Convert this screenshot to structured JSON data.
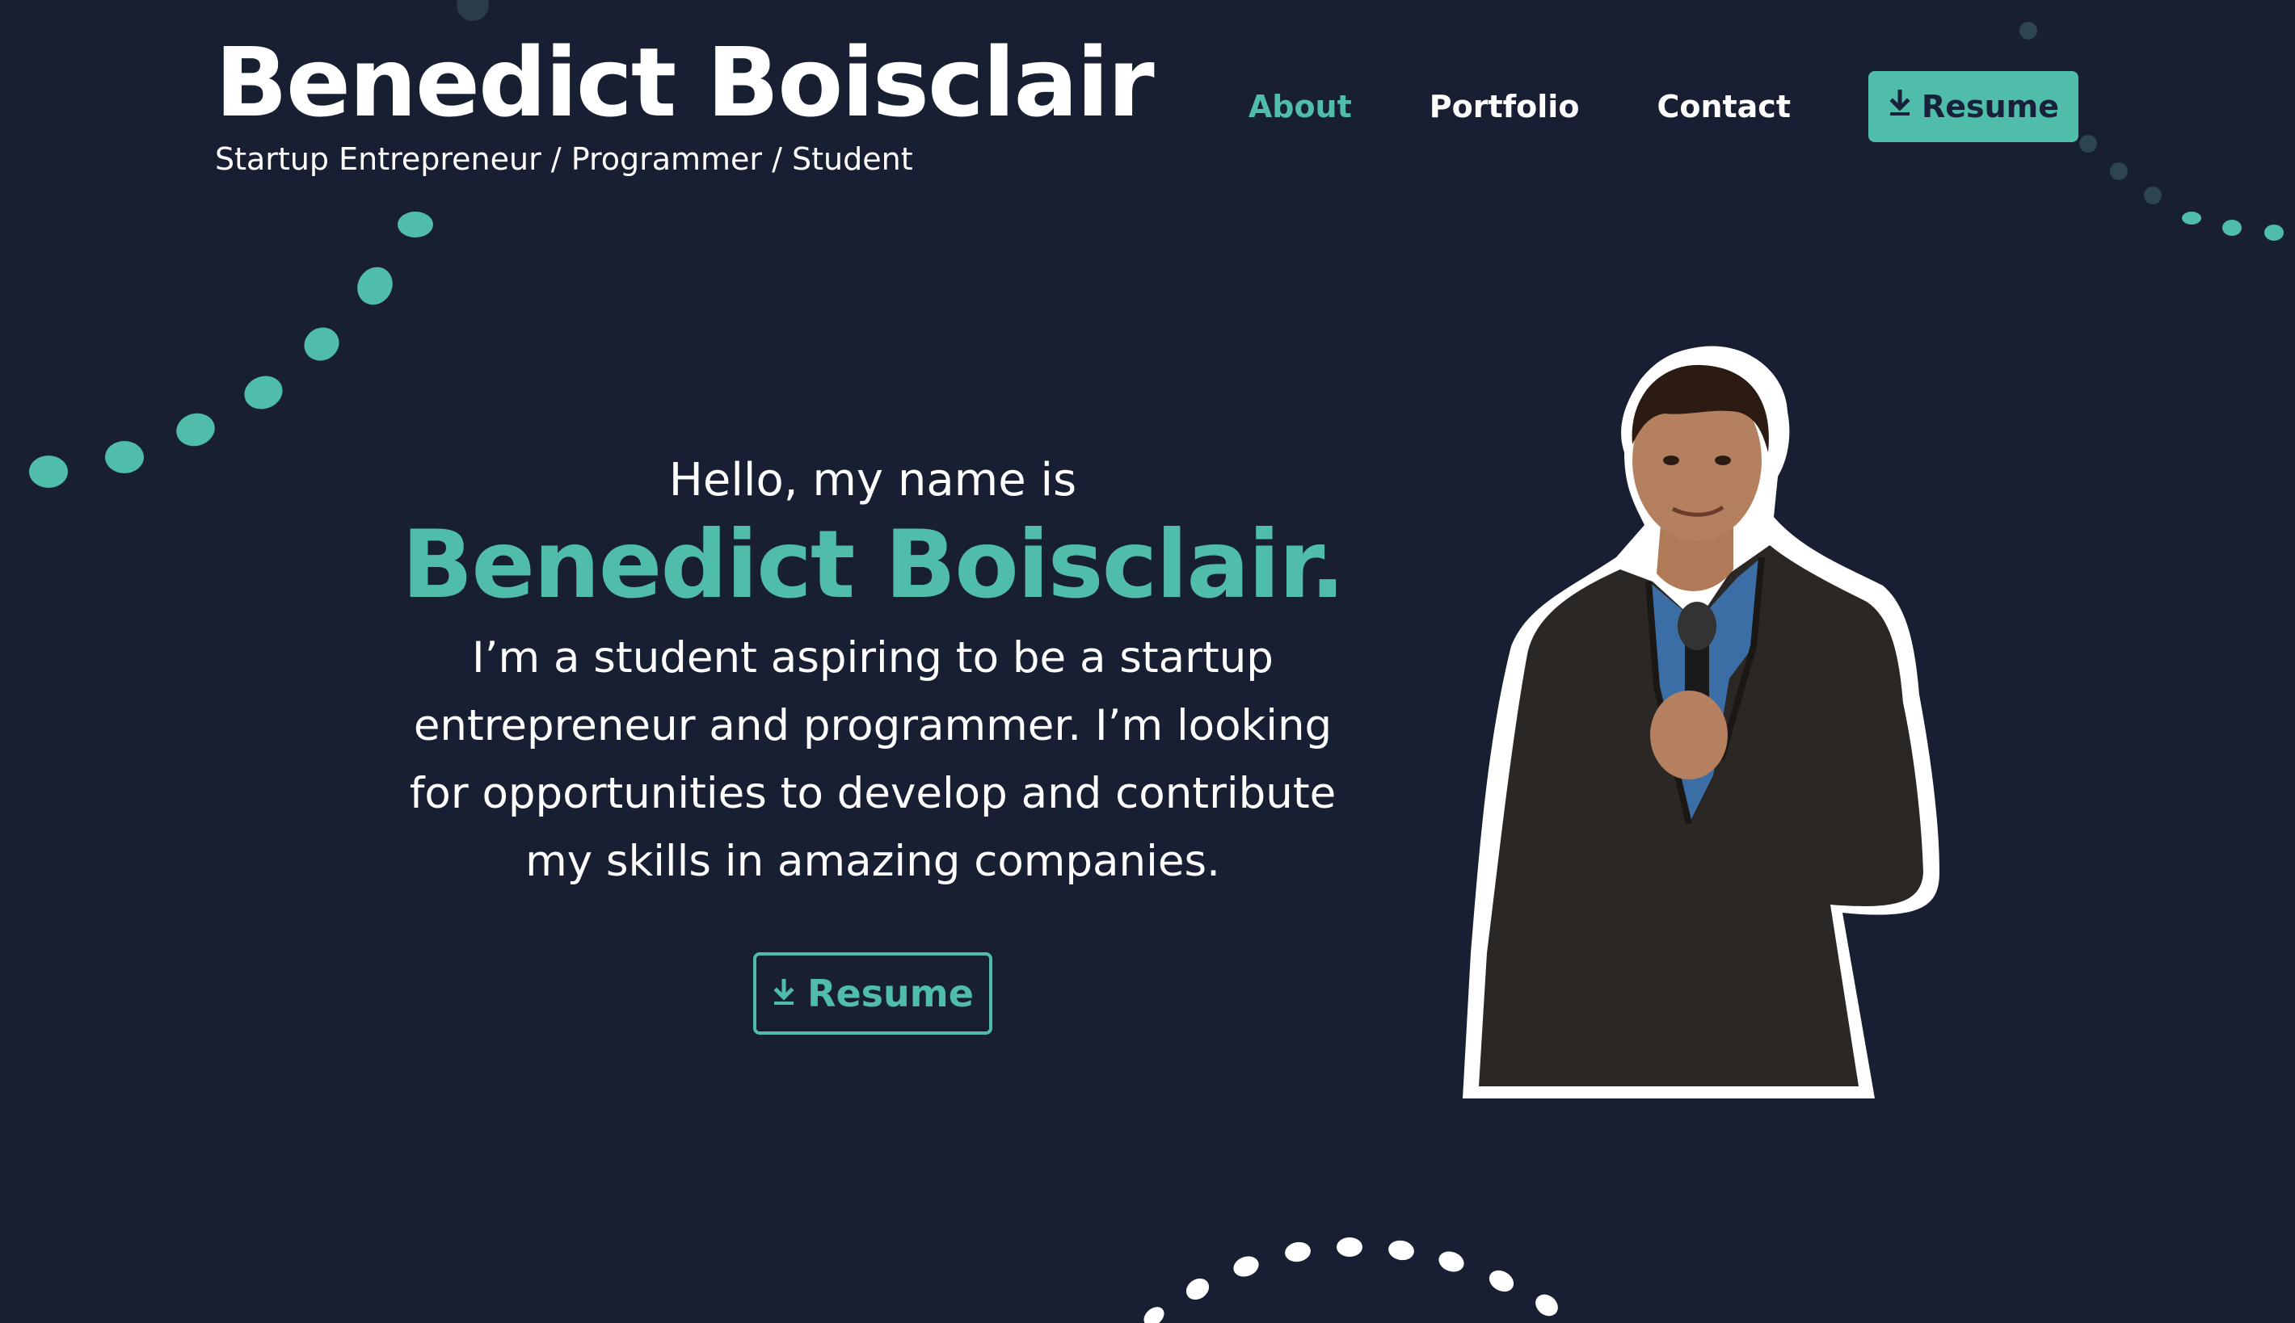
{
  "header": {
    "brand_name": "Benedict Boisclair",
    "tagline": "Startup Entrepreneur / Programmer / Student"
  },
  "nav": {
    "items": [
      {
        "label": "About",
        "active": true
      },
      {
        "label": "Portfolio",
        "active": false
      },
      {
        "label": "Contact",
        "active": false
      }
    ],
    "resume_label": "Resume",
    "resume_icon": "download-icon"
  },
  "hero": {
    "greeting": "Hello, my name is",
    "name": "Benedict Boisclair.",
    "description": "I’m a student aspiring to be a startup entrepreneur and programmer. I’m looking for opportunities to develop and contribute my skills in amazing companies.",
    "resume_label": "Resume",
    "resume_icon": "download-icon"
  },
  "portrait": {
    "alt": "portrait-photo"
  },
  "colors": {
    "background": "#181f33",
    "accent": "#4fbdaa",
    "text": "#ffffff"
  }
}
